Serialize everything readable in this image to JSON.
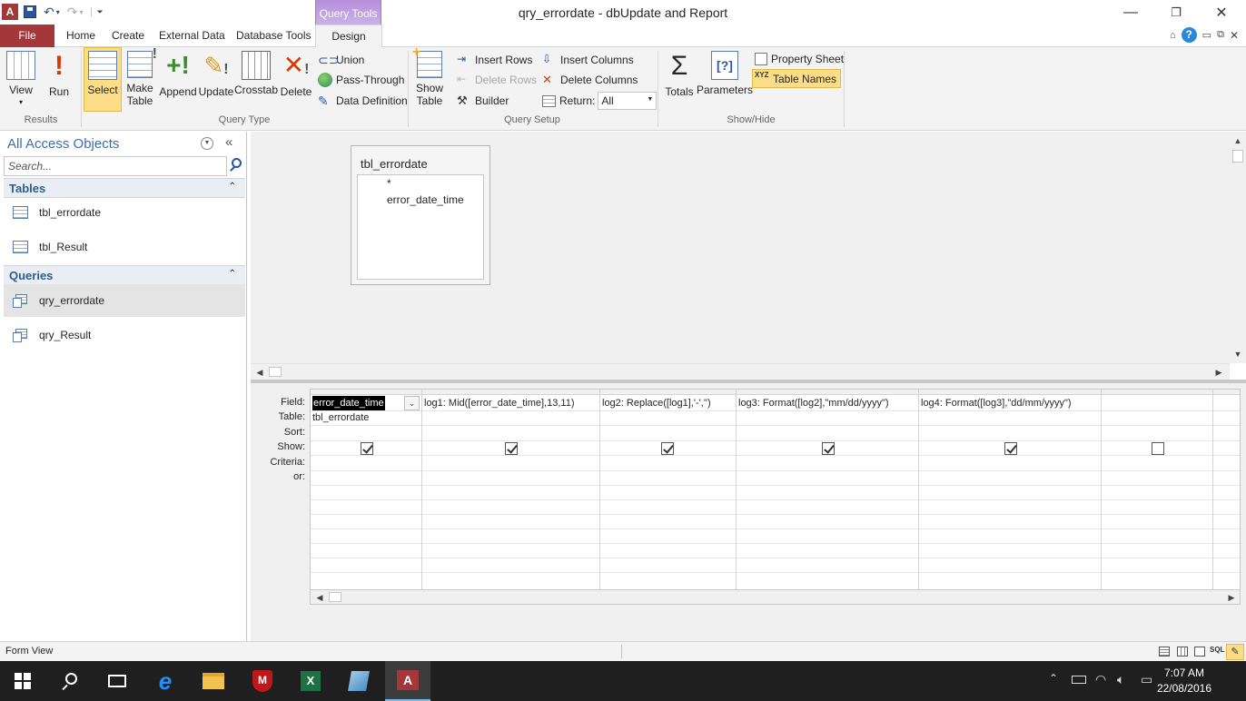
{
  "titlebar": {
    "window_title": "qry_errordate  -  dbUpdate and Report",
    "context_tab": "Query Tools",
    "minimize_glyph": "—",
    "restore_glyph": "❐",
    "close_glyph": "✕"
  },
  "tabs": {
    "file": "File",
    "home": "Home",
    "create": "Create",
    "external": "External Data",
    "dbtools": "Database Tools",
    "design": "Design"
  },
  "ribbon": {
    "results": {
      "label": "Results",
      "view": "View",
      "run": "Run"
    },
    "query_type": {
      "label": "Query Type",
      "select": "Select",
      "make_table_1": "Make",
      "make_table_2": "Table",
      "append": "Append",
      "update": "Update",
      "crosstab": "Crosstab",
      "delete": "Delete",
      "union": "Union",
      "pass_through": "Pass-Through",
      "data_definition": "Data Definition"
    },
    "query_setup": {
      "label": "Query Setup",
      "show_table_1": "Show",
      "show_table_2": "Table",
      "insert_rows": "Insert Rows",
      "delete_rows": "Delete Rows",
      "builder": "Builder",
      "insert_columns": "Insert Columns",
      "delete_columns": "Delete Columns",
      "return_label": "Return:",
      "return_value": "All"
    },
    "show_hide": {
      "label": "Show/Hide",
      "totals": "Totals",
      "parameters": "Parameters",
      "property_sheet": "Property Sheet",
      "table_names": "Table Names"
    }
  },
  "nav": {
    "title": "All Access Objects",
    "search_placeholder": "Search...",
    "tables_header": "Tables",
    "tables": [
      "tbl_errordate",
      "tbl_Result"
    ],
    "queries_header": "Queries",
    "queries": [
      "qry_errordate",
      "qry_Result"
    ]
  },
  "design": {
    "table_box": {
      "title": "tbl_errordate",
      "fields": [
        "*",
        "error_date_time"
      ]
    }
  },
  "qbe": {
    "row_labels": [
      "Field:",
      "Table:",
      "Sort:",
      "Show:",
      "Criteria:",
      "or:"
    ],
    "columns": [
      {
        "field": "error_date_time",
        "table": "tbl_errordate",
        "show": true
      },
      {
        "field": "log1: Mid([error_date_time],13,11)",
        "table": "",
        "show": true
      },
      {
        "field": "log2: Replace([log1],'-','')",
        "table": "",
        "show": true
      },
      {
        "field": "log3: Format([log2],\"mm/dd/yyyy\")",
        "table": "",
        "show": true
      },
      {
        "field": "log4: Format([log3],\"dd/mm/yyyy\")",
        "table": "",
        "show": true
      },
      {
        "field": "",
        "table": "",
        "show": false
      }
    ]
  },
  "status": {
    "text": "Form View",
    "sql_label": "SQL"
  },
  "taskbar": {
    "time": "7:07 AM",
    "date": "22/08/2016"
  }
}
